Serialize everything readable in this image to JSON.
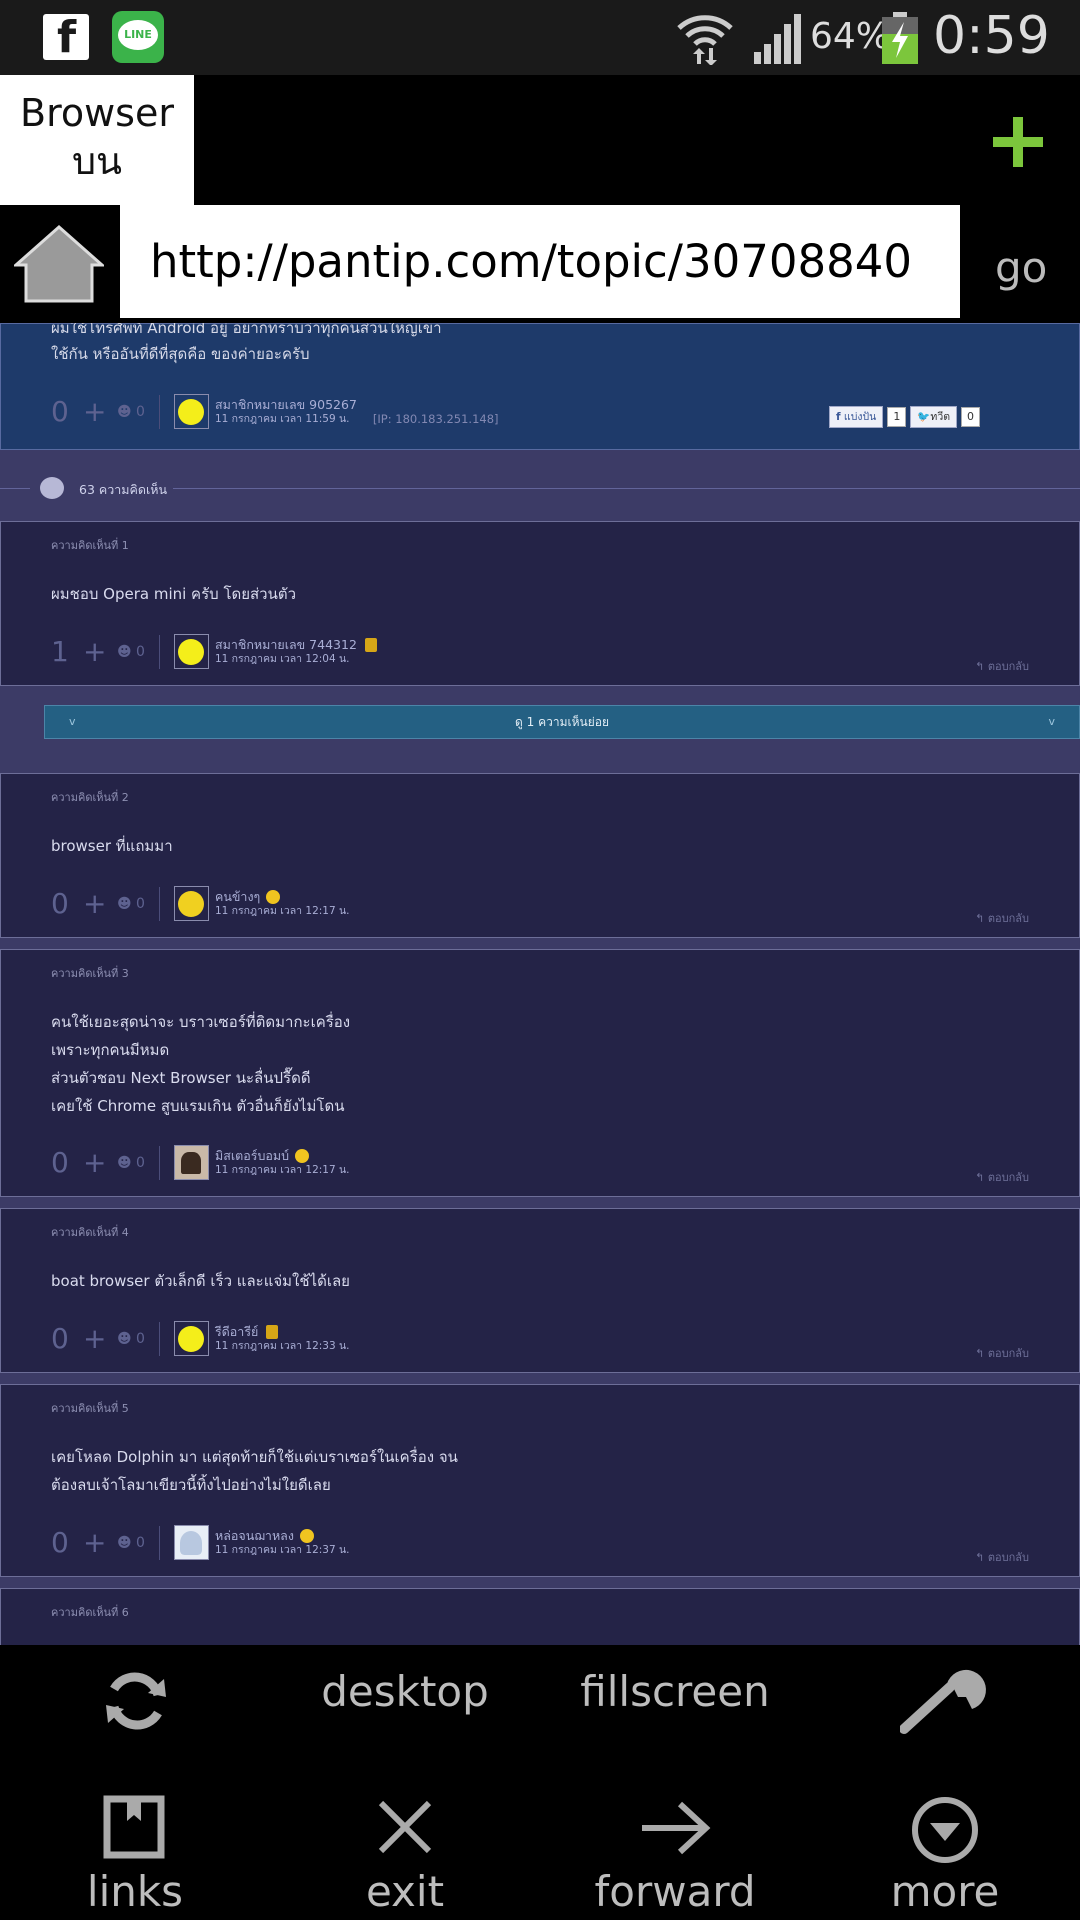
{
  "status_bar": {
    "battery": "64%",
    "time": "0:59",
    "icons": [
      "facebook-icon",
      "line-icon",
      "wifi-icon",
      "signal-icon",
      "battery-icon"
    ]
  },
  "tab": {
    "line1": "Browser",
    "line2": "บน"
  },
  "url_bar": {
    "url": "http://pantip.com/topic/30708840",
    "go": "go"
  },
  "topic": {
    "text_partial": "ผมใช้โทรศัพท์ Android อยู่ อยากทราบว่าทุกคนส่วนใหญ่เขา",
    "text_line2": "ใช้กัน หรืออันที่ดีที่สุดคือ ของค่ายอะครับ",
    "votes": "0",
    "emo": "0",
    "member": "สมาชิกหมายเลข 905267",
    "date": "11 กรกฎาคม เวลา 11:59 น.",
    "ip": "[IP: 180.183.251.148]",
    "share_fb": "แบ่งปัน",
    "share_fb_count": "1",
    "tweet": "ทวีต",
    "tweet_count": "0"
  },
  "comments_count": "63 ความคิดเห็น",
  "reply_label": "ตอบกลับ",
  "sub_comments": "ดู 1 ความเห็นย่อย",
  "comments": [
    {
      "label": "ความคิดเห็นที่ 1",
      "lines": [
        "ผมชอบ Opera mini ครับ โดยส่วนตัว"
      ],
      "votes": "1",
      "emo": "0",
      "member": "สมาชิกหมายเลข 744312",
      "date": "11 กรกฎาคม เวลา 12:04 น."
    },
    {
      "label": "ความคิดเห็นที่ 2",
      "lines": [
        "browser ที่แถมมา"
      ],
      "votes": "0",
      "emo": "0",
      "member": "คนข้างๆ",
      "date": "11 กรกฎาคม เวลา 12:17 น."
    },
    {
      "label": "ความคิดเห็นที่ 3",
      "lines": [
        "คนใช้เยอะสุดน่าจะ บราวเซอร์ที่ติดมากะเครื่อง",
        "เพราะทุกคนมีหมด",
        "ส่วนตัวชอบ Next Browser นะลื่นปรื๊ดดี",
        "เคยใช้ Chrome สูบแรมเกิน ตัวอื่นก็ยังไม่โดน"
      ],
      "votes": "0",
      "emo": "0",
      "member": "มิสเตอร์บอมบ์",
      "date": "11 กรกฎาคม เวลา 12:17 น."
    },
    {
      "label": "ความคิดเห็นที่ 4",
      "lines": [
        "boat browser ตัวเล็กดี เร็ว และแจ่มใช้ได้เลย"
      ],
      "votes": "0",
      "emo": "0",
      "member": "รีดีอารีย์",
      "date": "11 กรกฎาคม เวลา 12:33 น."
    },
    {
      "label": "ความคิดเห็นที่ 5",
      "lines": [
        "เคยโหลด Dolphin มา แต่สุดท้ายก็ใช้แต่เบราเซอร์ในเครื่อง จน",
        "ต้องลบเจ้าโลมาเขียวนี้ทิ้งไปอย่างไม่ใยดีเลย"
      ],
      "votes": "0",
      "emo": "0",
      "member": "หล่อจนฌาหลง",
      "date": "11 กรกฎาคม เวลา 12:37 น."
    },
    {
      "label": "ความคิดเห็นที่ 6",
      "lines": [],
      "votes": "",
      "emo": "",
      "member": "",
      "date": ""
    }
  ],
  "toolbar": {
    "desktop": "desktop",
    "fillscreen": "fillscreen",
    "links": "links",
    "exit": "exit",
    "forward": "forward",
    "more": "more"
  }
}
